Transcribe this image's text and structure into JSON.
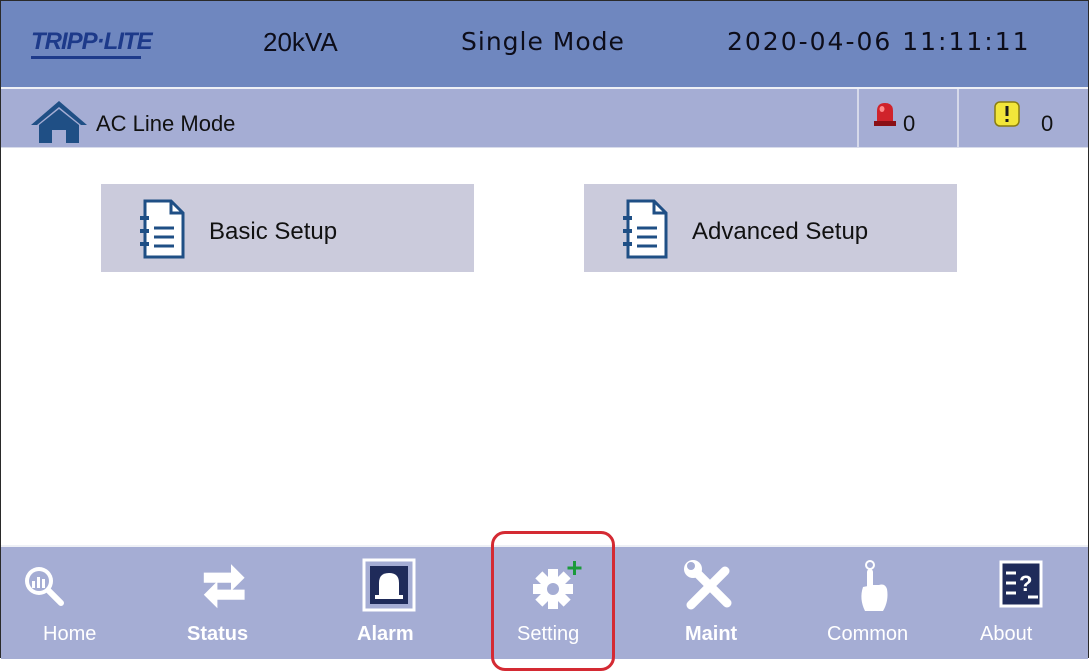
{
  "header": {
    "logo_text": "TRIPP·LITE",
    "capacity": "20kVA",
    "mode": "Single Mode",
    "datetime": "2020-04-06 11:11:11"
  },
  "statusbar": {
    "mode_label": "AC Line Mode",
    "alarm_count": "0",
    "warning_count": "0"
  },
  "main": {
    "cards": [
      {
        "label": "Basic Setup"
      },
      {
        "label": "Advanced Setup"
      }
    ]
  },
  "nav": {
    "items": [
      {
        "label": "Home",
        "icon": "magnifier-chart-icon"
      },
      {
        "label": "Status",
        "icon": "swap-arrows-icon"
      },
      {
        "label": "Alarm",
        "icon": "bell-icon"
      },
      {
        "label": "Setting",
        "icon": "gear-plus-icon",
        "active": true
      },
      {
        "label": "Maint",
        "icon": "wrench-screwdriver-icon"
      },
      {
        "label": "Common",
        "icon": "pointer-hand-icon"
      },
      {
        "label": "About",
        "icon": "help-book-icon"
      }
    ]
  },
  "colors": {
    "header_bg": "#6f87bf",
    "bar_bg": "#a5add4",
    "card_bg": "#cbcbdc",
    "highlight": "#d42a33"
  }
}
